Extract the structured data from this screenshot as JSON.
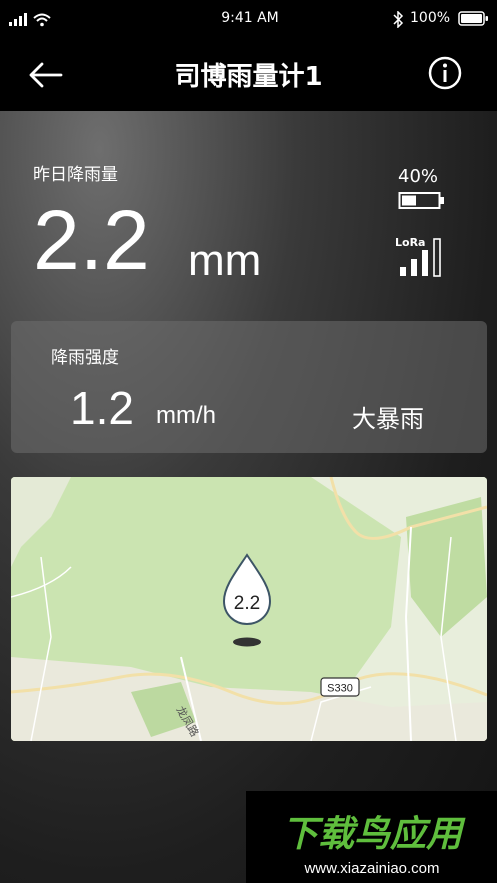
{
  "status_bar": {
    "time": "9:41 AM",
    "battery_percent": "100%"
  },
  "nav": {
    "title": "司博雨量计1"
  },
  "yesterday": {
    "label": "昨日降雨量",
    "value": "2.2",
    "unit": "mm"
  },
  "device": {
    "battery_percent": "40%",
    "battery_level": 0.4,
    "signal_label": "LoRa",
    "signal_bars": 3
  },
  "intensity": {
    "label": "降雨强度",
    "value": "1.2",
    "unit": "mm/h",
    "level": "大暴雨"
  },
  "map": {
    "marker_value": "2.2",
    "road_badge": "S330",
    "road_name": "龙凤路"
  },
  "watermark": {
    "brand": "下载鸟应用",
    "url": "www.xiazainiao.com"
  }
}
